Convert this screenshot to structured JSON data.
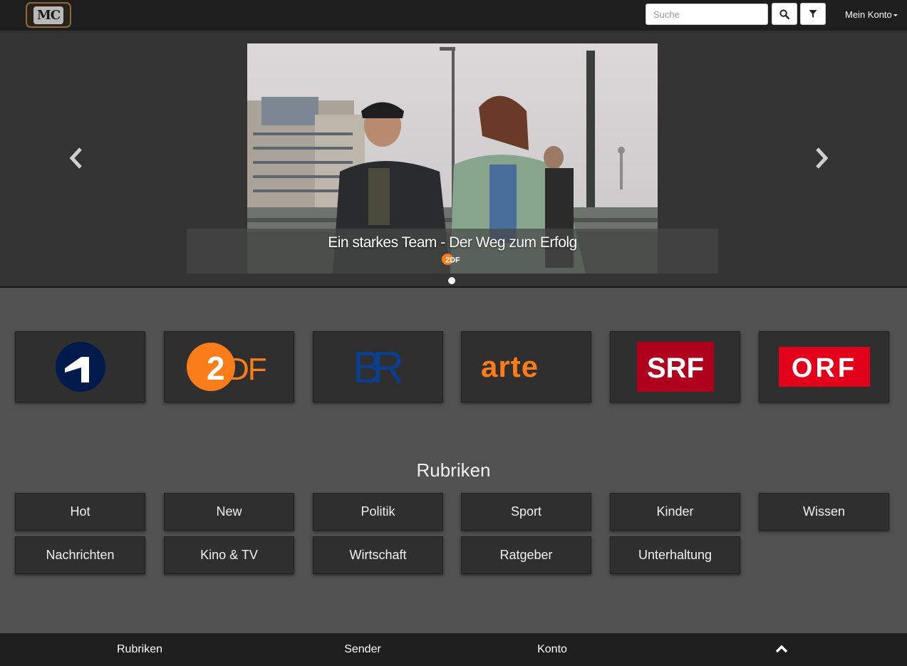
{
  "header": {
    "logo_text": "MC",
    "search_placeholder": "Suche",
    "search_icon": "search-icon",
    "filter_icon": "filter-icon",
    "account_label": "Mein Konto"
  },
  "carousel": {
    "slide_title": "Ein starkes Team - Der Weg zum Erfolg",
    "slide_channel_logo": "2DF",
    "prev_icon": "chevron-left-icon",
    "next_icon": "chevron-right-icon",
    "indicator_count": 1,
    "active_indicator": 1
  },
  "channels": [
    {
      "name": "1",
      "style": "ard"
    },
    {
      "name": "2DF",
      "style": "zdf"
    },
    {
      "name": "BR",
      "style": "br"
    },
    {
      "name": "arte",
      "style": "arte"
    },
    {
      "name": "SRF",
      "style": "srf"
    },
    {
      "name": "ORF",
      "style": "orf"
    }
  ],
  "categories": {
    "title": "Rubriken",
    "items": [
      "Hot",
      "New",
      "Politik",
      "Sport",
      "Kinder",
      "Wissen",
      "Nachrichten",
      "Kino & TV",
      "Wirtschaft",
      "Ratgeber",
      "Unterhaltung"
    ]
  },
  "bottom_nav": {
    "items": [
      "Rubriken",
      "Sender",
      "Konto"
    ],
    "up_icon": "chevron-up-icon"
  },
  "colors": {
    "zdf_orange": "#fa7d19",
    "ard_navy": "#001a4b",
    "br_blue": "#0b3e8c",
    "srf_red": "#af001e",
    "orf_red": "#e3001b"
  }
}
